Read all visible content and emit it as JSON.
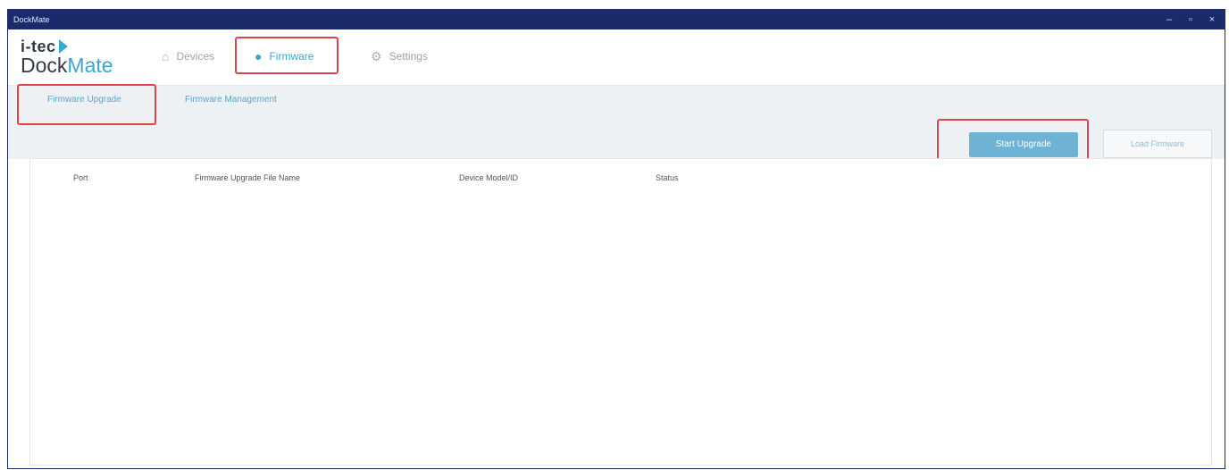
{
  "window": {
    "title": "DockMate",
    "controls": {
      "minimize": "–",
      "maximize": "▫",
      "close": "×"
    }
  },
  "logo": {
    "line1": "i-tec",
    "line2a": "Dock",
    "line2b": "Mate"
  },
  "nav": {
    "items": [
      {
        "label": "Devices",
        "icon": "home-icon"
      },
      {
        "label": "Firmware",
        "icon": "firmware-icon",
        "active": true
      },
      {
        "label": "Settings",
        "icon": "gear-icon"
      }
    ]
  },
  "subtabs": {
    "items": [
      {
        "label": "Firmware Upgrade",
        "active": true
      },
      {
        "label": "Firmware Management"
      }
    ]
  },
  "actions": {
    "primary_label": "Start Upgrade",
    "secondary_label": "Load Firmware"
  },
  "table": {
    "columns": [
      "Port",
      "Firmware Upgrade File Name",
      "Device Model/ID",
      "Status"
    ],
    "rows": []
  },
  "colors": {
    "accent": "#3aa7cf",
    "titlebar": "#1b2a6b",
    "highlight": "#e0434a",
    "toolbar_bg": "#eef1f4"
  }
}
